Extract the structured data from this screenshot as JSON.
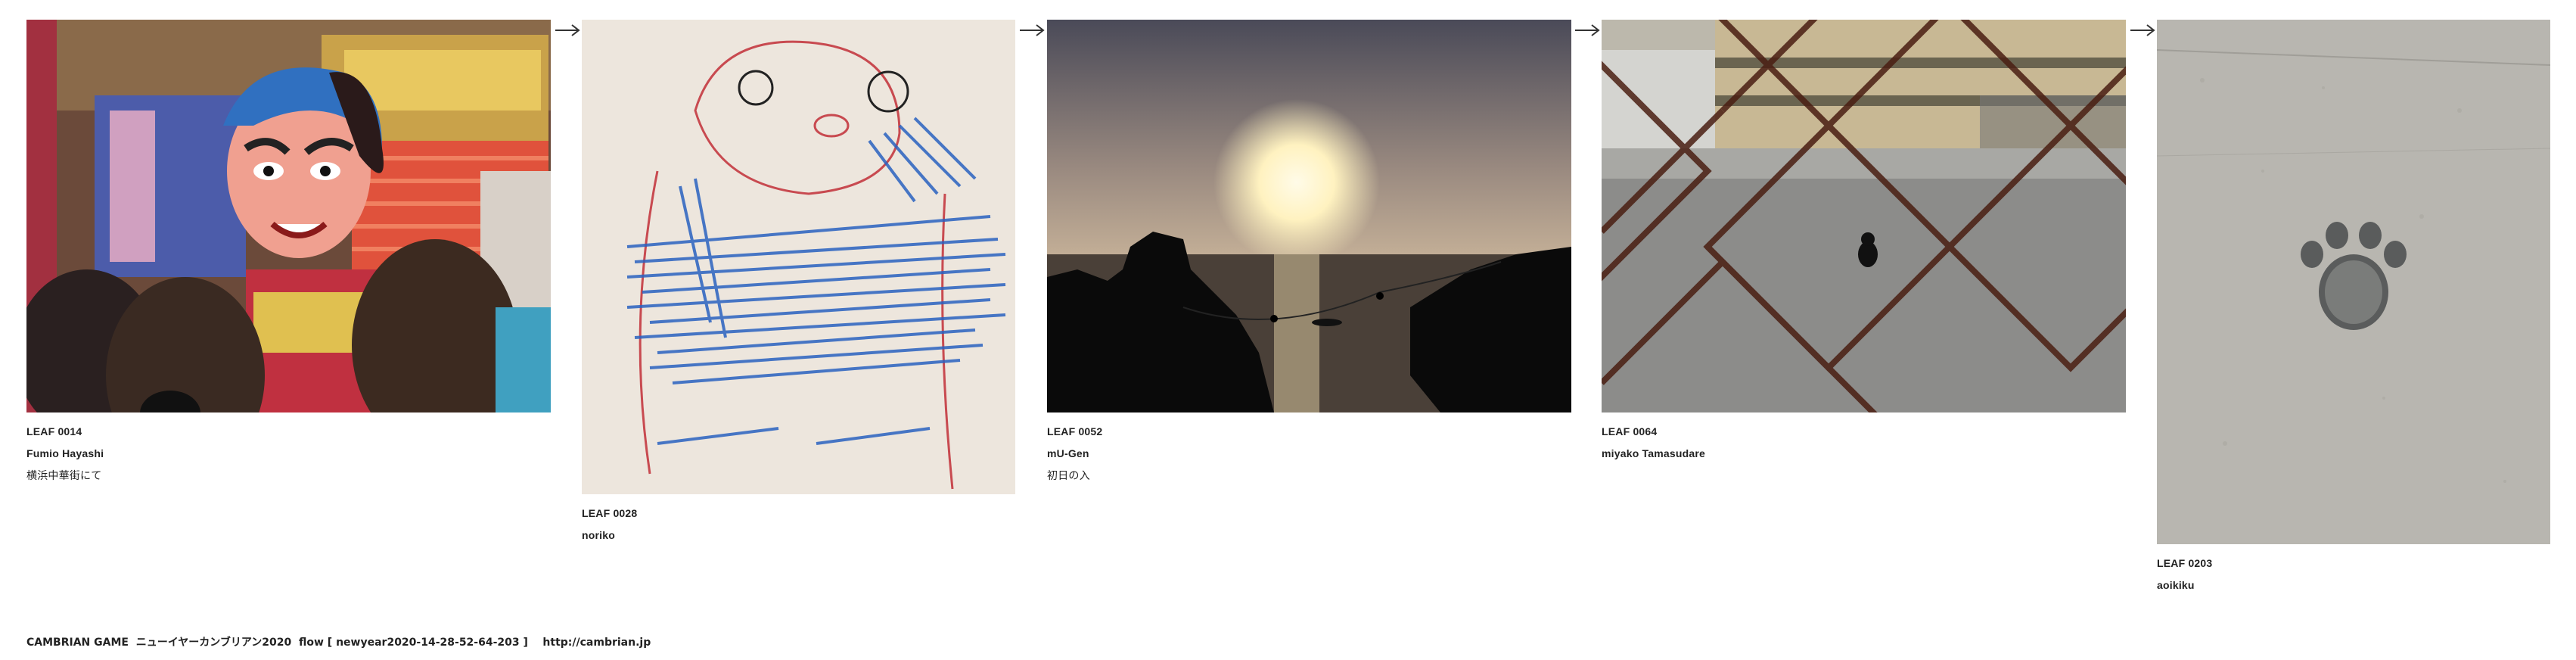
{
  "leaves": [
    {
      "code": "LEAF 0014",
      "author": "Fumio Hayashi",
      "caption": "横浜中華街にて",
      "photo": "festival-mask-photo"
    },
    {
      "code": "LEAF 0028",
      "author": "noriko",
      "caption": "",
      "photo": "crayon-drawing-photo"
    },
    {
      "code": "LEAF 0052",
      "author": "mU-Gen",
      "caption": "初日の入",
      "photo": "sunset-sea-photo"
    },
    {
      "code": "LEAF 0064",
      "author": "miyako Tamasudare",
      "caption": "",
      "photo": "cat-through-fence-photo"
    },
    {
      "code": "LEAF 0203",
      "author": "aoikiku",
      "caption": "",
      "photo": "paw-print-concrete-photo"
    }
  ],
  "footer": {
    "text": "CAMBRIAN GAME  ニューイヤーカンブリアン2020  flow [ newyear2020-14-28-52-64-203 ]    ",
    "link": "http://cambrian.jp"
  },
  "colors": {
    "background": "#ffffff",
    "text": "#222222",
    "arrow": "#333333"
  }
}
